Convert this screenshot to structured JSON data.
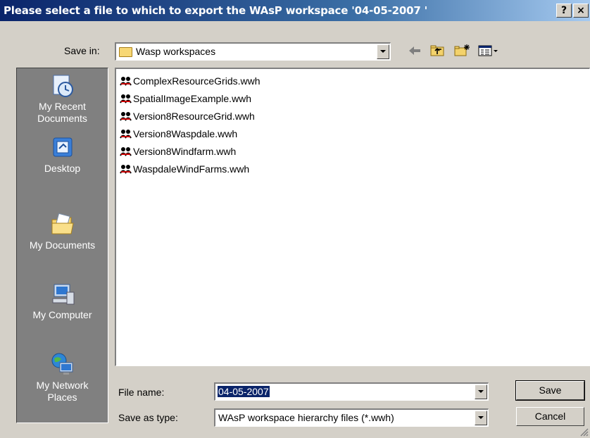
{
  "window": {
    "title": "Please select a file to which to export the WAsP workspace '04-05-2007 '",
    "help_label": "?",
    "close_label": "×"
  },
  "savein": {
    "label": "Save in:",
    "value": "Wasp workspaces"
  },
  "places": [
    {
      "label_line1": "My Recent",
      "label_line2": "Documents",
      "icon": "recent-documents-icon"
    },
    {
      "label_line1": "Desktop",
      "label_line2": "",
      "icon": "desktop-icon"
    },
    {
      "label_line1": "My Documents",
      "label_line2": "",
      "icon": "my-documents-icon"
    },
    {
      "label_line1": "My Computer",
      "label_line2": "",
      "icon": "my-computer-icon"
    },
    {
      "label_line1": "My Network",
      "label_line2": "Places",
      "icon": "network-places-icon"
    }
  ],
  "files": [
    {
      "name": "ComplexResourceGrids.wwh"
    },
    {
      "name": "SpatialImageExample.wwh"
    },
    {
      "name": "Version8ResourceGrid.wwh"
    },
    {
      "name": "Version8Waspdale.wwh"
    },
    {
      "name": "Version8Windfarm.wwh"
    },
    {
      "name": "WaspdaleWindFarms.wwh"
    }
  ],
  "filename": {
    "label": "File name:",
    "value": "04-05-2007"
  },
  "savetype": {
    "label": "Save as type:",
    "value": "WAsP workspace hierarchy files (*.wwh)"
  },
  "buttons": {
    "save": "Save",
    "cancel": "Cancel"
  },
  "colors": {
    "title_bar": "#0a246a",
    "dialog_bg": "#d4d0c8",
    "places_bar": "#808080",
    "selection": "#0a246a"
  }
}
